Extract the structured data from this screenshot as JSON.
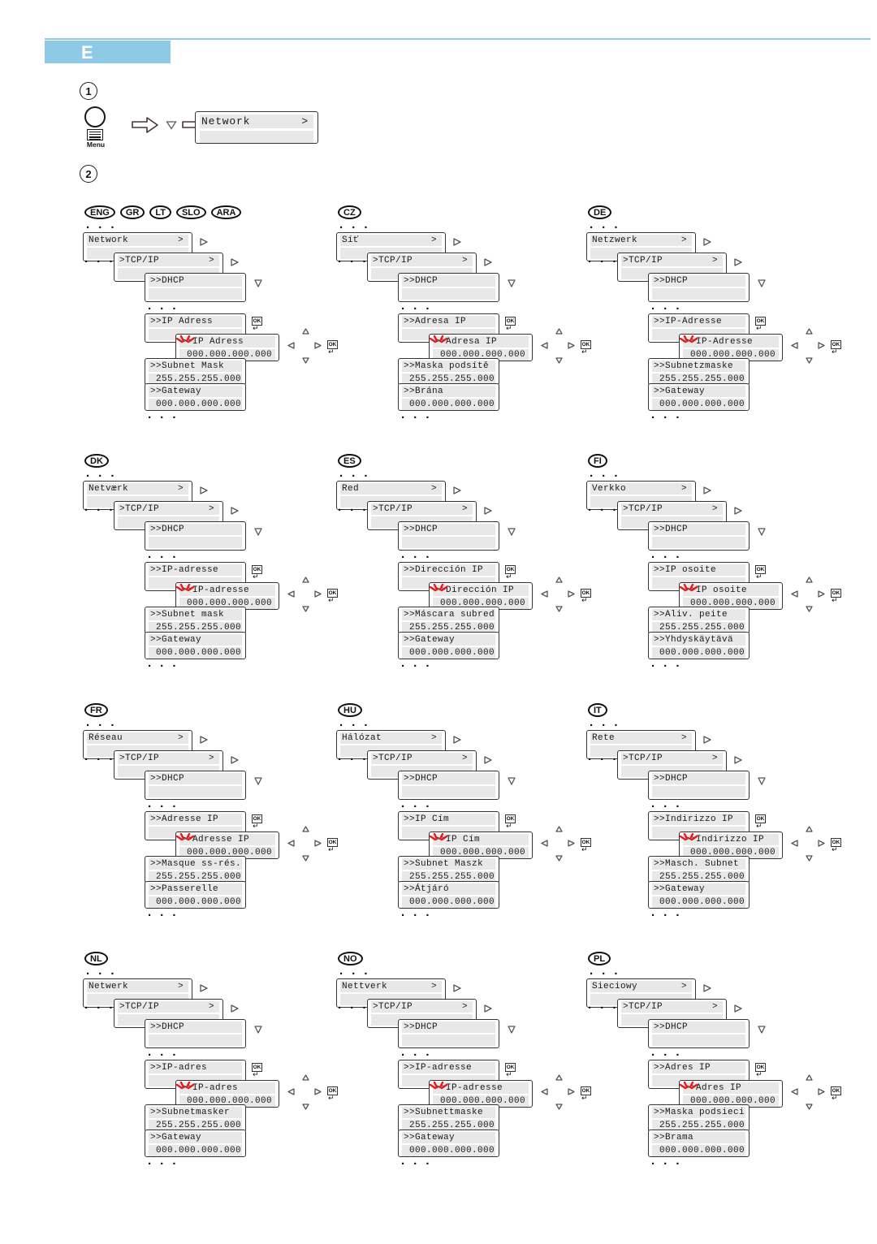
{
  "header": {
    "tab_label": "E",
    "accent_color": "#8ec9e6"
  },
  "steps": {
    "one": "1",
    "two": "2"
  },
  "step1": {
    "menu_button_label": "Menu",
    "menu_icon": "menu-button-icon",
    "arrow_icon": "right-arrow-icon",
    "down_icon": "down-triangle-icon",
    "display": {
      "line1": "Network",
      "caret": ">",
      "line2": ""
    }
  },
  "common": {
    "dots": "· · ·",
    "tcpip": ">TCP/IP",
    "tcpip_caret": ">",
    "dhcp": ">>DHCP",
    "menu_caret": ">",
    "ip_zero": "000.000.000.000",
    "subnet_value": "255.255.255.000",
    "ok_label": "OK",
    "ok_return": "↵",
    "right_tri": "▷",
    "down_tri": "▽",
    "up_tri": "△",
    "left_tri": "◁"
  },
  "groups": [
    {
      "id": "eng",
      "badges": [
        "ENG",
        "GR",
        "LT",
        "SLO",
        "ARA"
      ],
      "network": "Network",
      "ip_label": ">>IP Adress",
      "ip_edit_label": ">>IP Adress",
      "subnet_label": ">>Subnet Mask",
      "gateway_label": ">>Gateway"
    },
    {
      "id": "cz",
      "badges": [
        "CZ"
      ],
      "network": "Síť",
      "ip_label": ">>Adresa IP",
      "ip_edit_label": ">>Adresa IP",
      "subnet_label": ">>Maska podsítě",
      "gateway_label": ">>Brána"
    },
    {
      "id": "de",
      "badges": [
        "DE"
      ],
      "network": "Netzwerk",
      "ip_label": ">>IP-Adresse",
      "ip_edit_label": ">>IP-Adresse",
      "subnet_label": ">>Subnetzmaske",
      "gateway_label": ">>Gateway"
    },
    {
      "id": "dk",
      "badges": [
        "DK"
      ],
      "network": "Netværk",
      "ip_label": ">>IP-adresse",
      "ip_edit_label": ">>IP-adresse",
      "subnet_label": ">>Subnet mask",
      "gateway_label": ">>Gateway"
    },
    {
      "id": "es",
      "badges": [
        "ES"
      ],
      "network": "Red",
      "ip_label": ">>Dirección IP",
      "ip_edit_label": ">>Dirección IP",
      "subnet_label": ">>Máscara subred",
      "gateway_label": ">>Gateway"
    },
    {
      "id": "fi",
      "badges": [
        "FI"
      ],
      "network": "Verkko",
      "ip_label": ">>IP osoite",
      "ip_edit_label": ">>IP osoite",
      "subnet_label": ">>Aliv. peite",
      "gateway_label": ">>Yhdyskäytävä"
    },
    {
      "id": "fr",
      "badges": [
        "FR"
      ],
      "network": "Réseau",
      "ip_label": ">>Adresse IP",
      "ip_edit_label": ">>Adresse IP",
      "subnet_label": ">>Masque ss-rés.",
      "gateway_label": ">>Passerelle"
    },
    {
      "id": "hu",
      "badges": [
        "HU"
      ],
      "network": "Hálózat",
      "ip_label": ">>IP Cím",
      "ip_edit_label": ">>IP Cím",
      "subnet_label": ">>Subnet Maszk",
      "gateway_label": ">>Átjáró"
    },
    {
      "id": "it",
      "badges": [
        "IT"
      ],
      "network": "Rete",
      "ip_label": ">>Indirizzo IP",
      "ip_edit_label": ">>Indirizzo IP",
      "subnet_label": ">>Masch. Subnet",
      "gateway_label": ">>Gateway"
    },
    {
      "id": "nl",
      "badges": [
        "NL"
      ],
      "network": "Netwerk",
      "ip_label": ">>IP-adres",
      "ip_edit_label": ">>IP-adres",
      "subnet_label": ">>Subnetmasker",
      "gateway_label": ">>Gateway"
    },
    {
      "id": "no",
      "badges": [
        "NO"
      ],
      "network": "Nettverk",
      "ip_label": ">>IP-adresse",
      "ip_edit_label": ">>IP-adresse",
      "subnet_label": ">>Subnettmaske",
      "gateway_label": ">>Gateway"
    },
    {
      "id": "pl",
      "badges": [
        "PL"
      ],
      "network": "Sieciowy",
      "ip_label": ">>Adres IP",
      "ip_edit_label": ">>Adres IP",
      "subnet_label": ">>Maska podsieci",
      "gateway_label": ">>Brama"
    }
  ]
}
